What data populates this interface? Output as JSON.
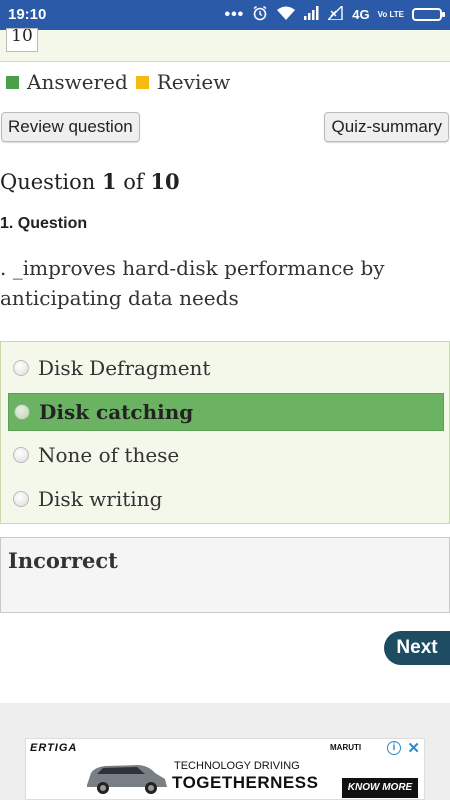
{
  "status_bar": {
    "time": "19:10",
    "network": "4G",
    "volte_label": "Vo LTE"
  },
  "top_panel": {
    "question_box_value": "10"
  },
  "legend": {
    "answered_label": "Answered",
    "review_label": "Review",
    "answered_color": "#4aa04a",
    "review_color": "#f6ba12"
  },
  "toolbar": {
    "review_question_label": "Review question",
    "quiz_summary_label": "Quiz-summary"
  },
  "question_counter": {
    "prefix": "Question",
    "current": "1",
    "of_label": "of",
    "total": "10"
  },
  "question": {
    "heading": "1. Question",
    "text": ". _improves hard-disk performance by anticipating data needs"
  },
  "options": [
    {
      "label": "Disk Defragment",
      "selected": false
    },
    {
      "label": "Disk catching",
      "selected": true
    },
    {
      "label": "None of these",
      "selected": false
    },
    {
      "label": "Disk writing",
      "selected": false
    }
  ],
  "feedback": {
    "title": "Incorrect"
  },
  "navigation": {
    "next_label": "Next"
  },
  "ad": {
    "brand": "ERTIGA",
    "maker": "MARUTI",
    "line1": "TECHNOLOGY DRIVING",
    "line2": "TOGETHERNESS",
    "cta": "KNOW MORE",
    "info_glyph": "i",
    "close_glyph": "✕"
  }
}
